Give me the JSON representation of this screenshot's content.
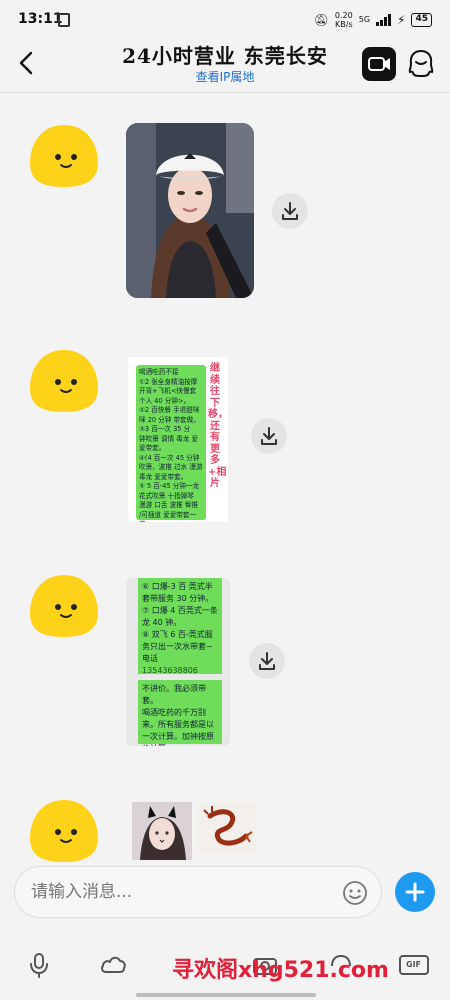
{
  "status_bar": {
    "time": "13:11",
    "net_speed_value": "0.20",
    "net_speed_unit": "KB/s",
    "network": "5G",
    "battery": "45"
  },
  "header": {
    "title": "24小时营业 东莞长安",
    "subtitle": "查看IP属地"
  },
  "messages": {
    "m2_lines": [
      "喝酒吃药不接",
      "①2 张全身精油按摩",
      "开背+飞机<快慢套",
      "个人 40 分钟>。",
      "②2 百快餐 手退甜咪",
      "咪 20 分钟 带套做。",
      "③3 百一次 35 分",
      "钟吹箫 调情 毒龙 爱",
      "爱带套。",
      "④(4 百一次 45 分钟",
      "吹箫，波推 过水 漫游",
      "毒龙 爱爱带套。",
      "⑤ 5 百-45 分钟一龙",
      "花式吹箫 十指弹琴",
      "漫游 口舌 波推 臀推",
      "/可插道 爱爱带套一",
      "次。"
    ],
    "m2_side_text": "继续往下移，还有更多+相片",
    "m3_lines_a": [
      "⑥ 口爆-3 百 莞式半",
      "套带服务 30 分钟。",
      "⑦ 口爆 4 百莞式一条",
      "龙 40 钟。",
      "⑧ 双飞 6 百-莞式服",
      "务只出一次水带套~",
      "电话"
    ],
    "m3_phone": "13543638806",
    "m3_lines_b": [
      "不讲价。我必须带套。",
      "喝酒吃药的千万别",
      "来。所有服务都是以",
      "一次计算。加钟按原",
      "价计算。"
    ]
  },
  "input": {
    "placeholder": "请输入消息..."
  },
  "toolbar": {
    "gif_label": "GIF"
  },
  "watermark": "寻欢阁xhg521.com",
  "colors": {
    "accent_blue": "#1e9bf0",
    "link_blue": "#1a6fd6",
    "bubble_green": "#6fdd5a",
    "watermark_red": "#e2203a",
    "avatar_yellow": "#ffd21a"
  },
  "icons": {
    "back": "chevron-left-icon",
    "video": "video-call-icon",
    "profile": "ghost-profile-icon",
    "download": "download-icon",
    "emoji": "smiley-icon",
    "plus": "plus-icon",
    "mic": "microphone-icon",
    "cloud": "cloud-icon",
    "gif": "gif-icon"
  }
}
